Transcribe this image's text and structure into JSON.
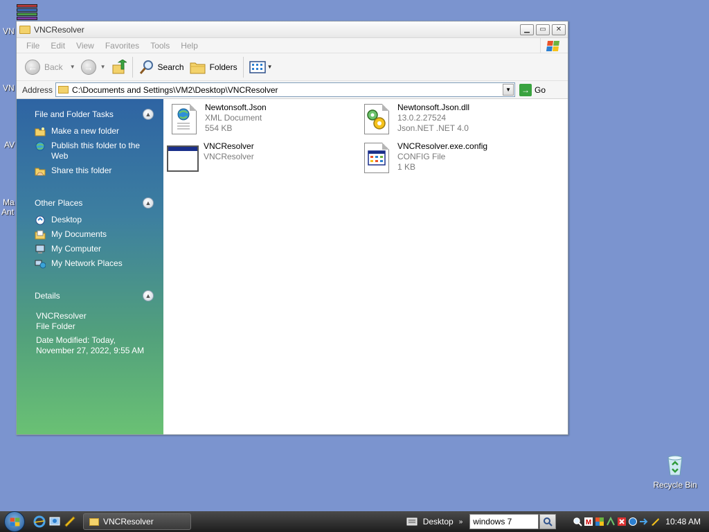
{
  "desktop": {
    "partial_labels": [
      "VN",
      "VN",
      "AV",
      "Ma",
      "Ant"
    ],
    "recycle_bin_label": "Recycle Bin"
  },
  "window": {
    "title": "VNCResolver",
    "menu": [
      "File",
      "Edit",
      "View",
      "Favorites",
      "Tools",
      "Help"
    ],
    "toolbar": {
      "back_label": "Back",
      "search_label": "Search",
      "folders_label": "Folders"
    },
    "address": {
      "label": "Address",
      "value": "C:\\Documents and Settings\\VM2\\Desktop\\VNCResolver",
      "go_label": "Go"
    },
    "taskpane": {
      "file_tasks": {
        "title": "File and Folder Tasks",
        "items": [
          {
            "label": "Make a new folder",
            "icon": "new-folder-icon"
          },
          {
            "label": "Publish this folder to the Web",
            "icon": "publish-web-icon"
          },
          {
            "label": "Share this folder",
            "icon": "share-folder-icon"
          }
        ]
      },
      "other_places": {
        "title": "Other Places",
        "items": [
          {
            "label": "Desktop",
            "icon": "desktop-icon"
          },
          {
            "label": "My Documents",
            "icon": "my-documents-icon"
          },
          {
            "label": "My Computer",
            "icon": "my-computer-icon"
          },
          {
            "label": "My Network Places",
            "icon": "network-places-icon"
          }
        ]
      },
      "details": {
        "title": "Details",
        "name": "VNCResolver",
        "type": "File Folder",
        "modified_line1": "Date Modified: Today,",
        "modified_line2": "November 27, 2022, 9:55 AM"
      }
    },
    "files": [
      {
        "name": "Newtonsoft.Json",
        "line2": "XML Document",
        "line3": "554 KB",
        "icon": "xml-document-icon"
      },
      {
        "name": "Newtonsoft.Json.dll",
        "line2": "13.0.2.27524",
        "line3": "Json.NET .NET 4.0",
        "icon": "dll-gear-icon"
      },
      {
        "name": "VNCResolver",
        "line2": "VNCResolver",
        "line3": "",
        "icon": "application-icon"
      },
      {
        "name": "VNCResolver.exe.config",
        "line2": "CONFIG File",
        "line3": "1 KB",
        "icon": "config-file-icon"
      }
    ]
  },
  "taskbar": {
    "task_button_label": "VNCResolver",
    "desktop_toolbar_label": "Desktop",
    "search_value": "windows 7",
    "clock": "10:48 AM"
  },
  "colors": {
    "desktop_bg": "#7b94cf",
    "taskpane_top": "#2e64a3",
    "taskpane_bottom": "#6ac174"
  }
}
